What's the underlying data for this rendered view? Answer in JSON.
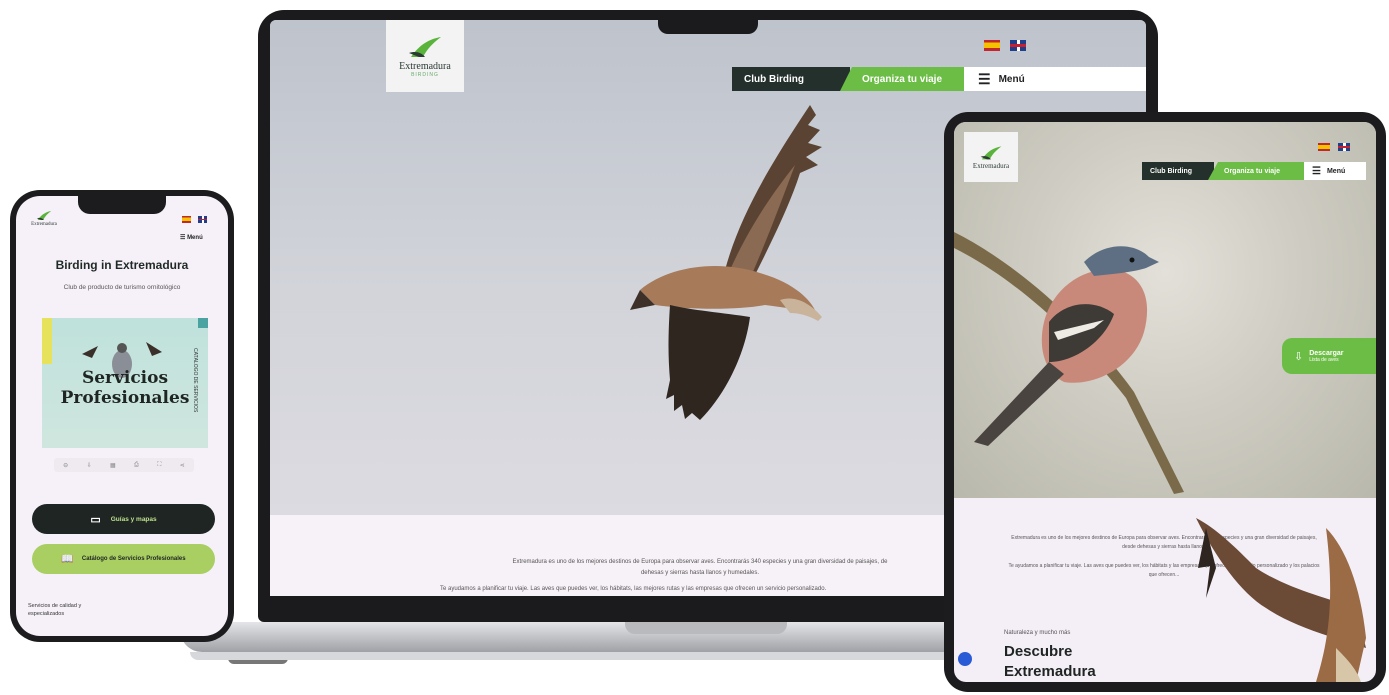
{
  "brand": {
    "logo_text": "Extremadura",
    "logo_sub": "BIRDING"
  },
  "laptop": {
    "nav": {
      "club": "Club Birding",
      "organize": "Organiza tu viaje",
      "menu": "Menú"
    },
    "paragraph_1": "Extremadura es uno de los mejores destinos de Europa para observar aves. Encontrarás 340 especies y una gran diversidad de paisajes, de",
    "paragraph_2": "dehesas y sierras hasta llanos y humedales.",
    "paragraph_3": "Te ayudamos a planificar tu viaje. Las aves que puedes ver, los hábitats, las mejores rutas y las empresas que ofrecen un servicio personalizado."
  },
  "phone": {
    "menu": "Menú",
    "title": "Birding in Extremadura",
    "subtitle": "Club de producto de turismo ornitológico",
    "brochure": {
      "title_line1": "Servicios",
      "title_line2": "Profesionales",
      "side_text": "CATÁLOGO DE SERVICIOS"
    },
    "buttons": {
      "guides": "Guías y mapas",
      "catalog": "Catálogo de Servicios Profesionales"
    },
    "footer": "Servicios de calidad y especializados"
  },
  "tablet": {
    "nav": {
      "club": "Club Birding",
      "organize": "Organiza tu viaje",
      "menu": "Menú"
    },
    "download": {
      "label": "Descargar",
      "sub": "Lista de aves"
    },
    "paragraph_1": "Extremadura es uno de los mejores destinos de Europa para observar aves. Encontrarás 340 especies y una gran diversidad de paisajes, desde dehesas y sierras hasta llanos.",
    "paragraph_2": "Te ayudamos a planificar tu viaje. Las aves que puedes ver, los hábitats y las empresas que ofrecen un servicio personalizado y los palacios que ofrecen...",
    "kicker": "Naturaleza y mucho más",
    "heading_1": "Descubre",
    "heading_2": "Extremadura"
  },
  "colors": {
    "brand_green": "#6cbd45",
    "dark_nav": "#24302c",
    "lime": "#a9cf62"
  }
}
